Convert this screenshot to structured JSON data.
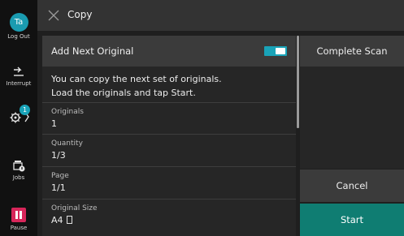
{
  "rail": {
    "user_initials": "Ta",
    "logout_label": "Log Out",
    "interrupt_label": "Interrupt",
    "settings_badge": "1",
    "jobs_label": "Jobs",
    "pause_label": "Pause"
  },
  "header": {
    "title": "Copy"
  },
  "panel": {
    "add_next_original_label": "Add Next Original",
    "add_next_original_on": true,
    "message_line1": "You can copy the next set of originals.",
    "message_line2": "Load the originals and tap Start.",
    "fields": [
      {
        "label": "Originals",
        "value": "1"
      },
      {
        "label": "Quantity",
        "value": "1/3"
      },
      {
        "label": "Page",
        "value": "1/1"
      },
      {
        "label": "Original Size",
        "value": "A4"
      }
    ]
  },
  "actions": {
    "complete_scan_label": "Complete Scan",
    "cancel_label": "Cancel",
    "start_label": "Start"
  },
  "colors": {
    "accent": "#19a3b8",
    "start": "#0f7d72",
    "pause": "#d7265a"
  }
}
